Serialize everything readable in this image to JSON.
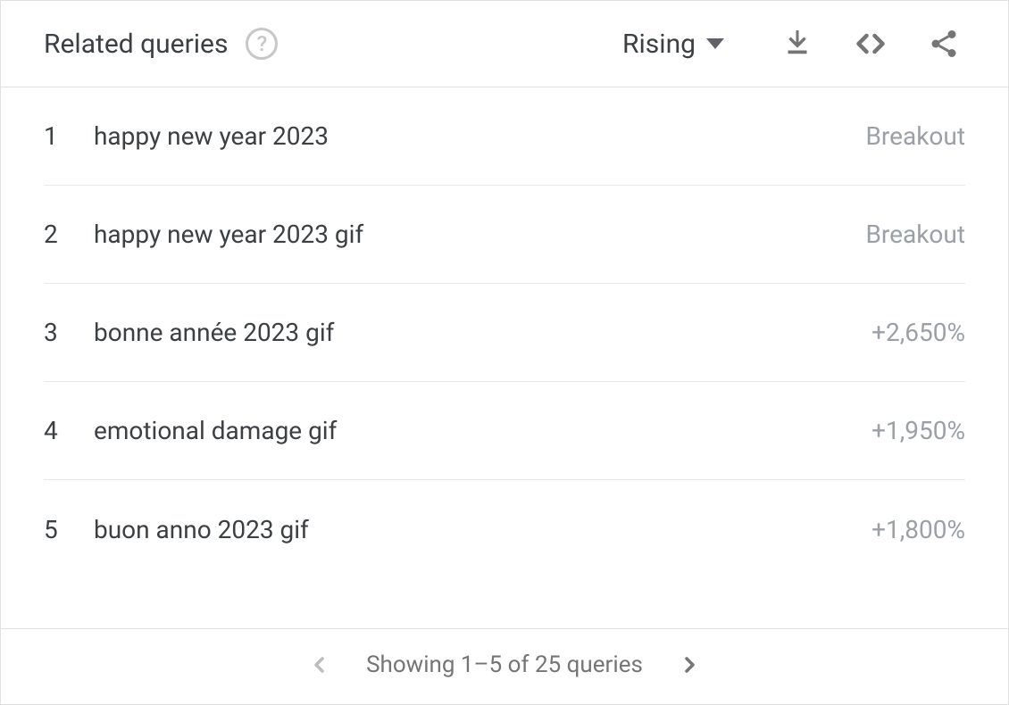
{
  "header": {
    "title": "Related queries",
    "sort_label": "Rising"
  },
  "queries": [
    {
      "rank": "1",
      "text": "happy new year 2023",
      "value": "Breakout"
    },
    {
      "rank": "2",
      "text": "happy new year 2023 gif",
      "value": "Breakout"
    },
    {
      "rank": "3",
      "text": "bonne année 2023 gif",
      "value": "+2,650%"
    },
    {
      "rank": "4",
      "text": "emotional damage gif",
      "value": "+1,950%"
    },
    {
      "rank": "5",
      "text": "buon anno 2023 gif",
      "value": "+1,800%"
    }
  ],
  "footer": {
    "pager_text": "Showing 1–5 of 25 queries"
  },
  "colors": {
    "icon_gray": "#757575",
    "text_primary": "#3c4043",
    "text_muted": "#9aa0a6"
  }
}
